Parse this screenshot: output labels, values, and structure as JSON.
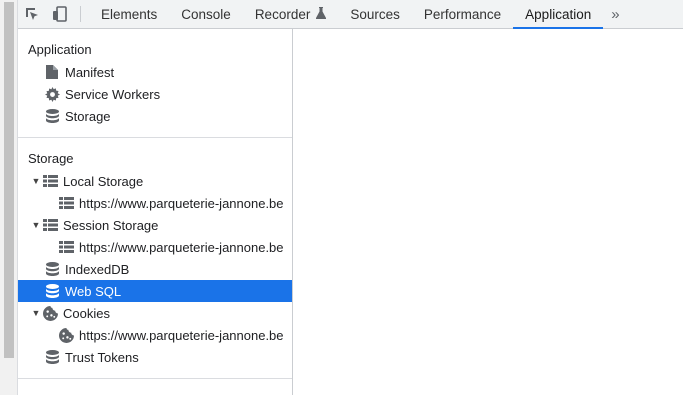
{
  "toolbar": {
    "tabs": [
      {
        "label": "Elements"
      },
      {
        "label": "Console"
      },
      {
        "label": "Recorder"
      },
      {
        "label": "Sources"
      },
      {
        "label": "Performance"
      },
      {
        "label": "Application"
      }
    ],
    "active_tab": "Application",
    "more_label": "»"
  },
  "sidebar": {
    "application": {
      "title": "Application",
      "items": [
        {
          "label": "Manifest",
          "icon": "file-icon"
        },
        {
          "label": "Service Workers",
          "icon": "gear-icon"
        },
        {
          "label": "Storage",
          "icon": "database-icon"
        }
      ]
    },
    "storage": {
      "title": "Storage",
      "local_storage": {
        "label": "Local Storage",
        "child": "https://www.parqueterie-jannone.be"
      },
      "session_storage": {
        "label": "Session Storage",
        "child": "https://www.parqueterie-jannone.be"
      },
      "indexeddb": {
        "label": "IndexedDB"
      },
      "websql": {
        "label": "Web SQL"
      },
      "cookies": {
        "label": "Cookies",
        "child": "https://www.parqueterie-jannone.be"
      },
      "trust_tokens": {
        "label": "Trust Tokens"
      }
    }
  },
  "colors": {
    "accent": "#1a73e8",
    "toolbar_bg": "#f1f3f4",
    "selection_text": "#ffffff"
  }
}
